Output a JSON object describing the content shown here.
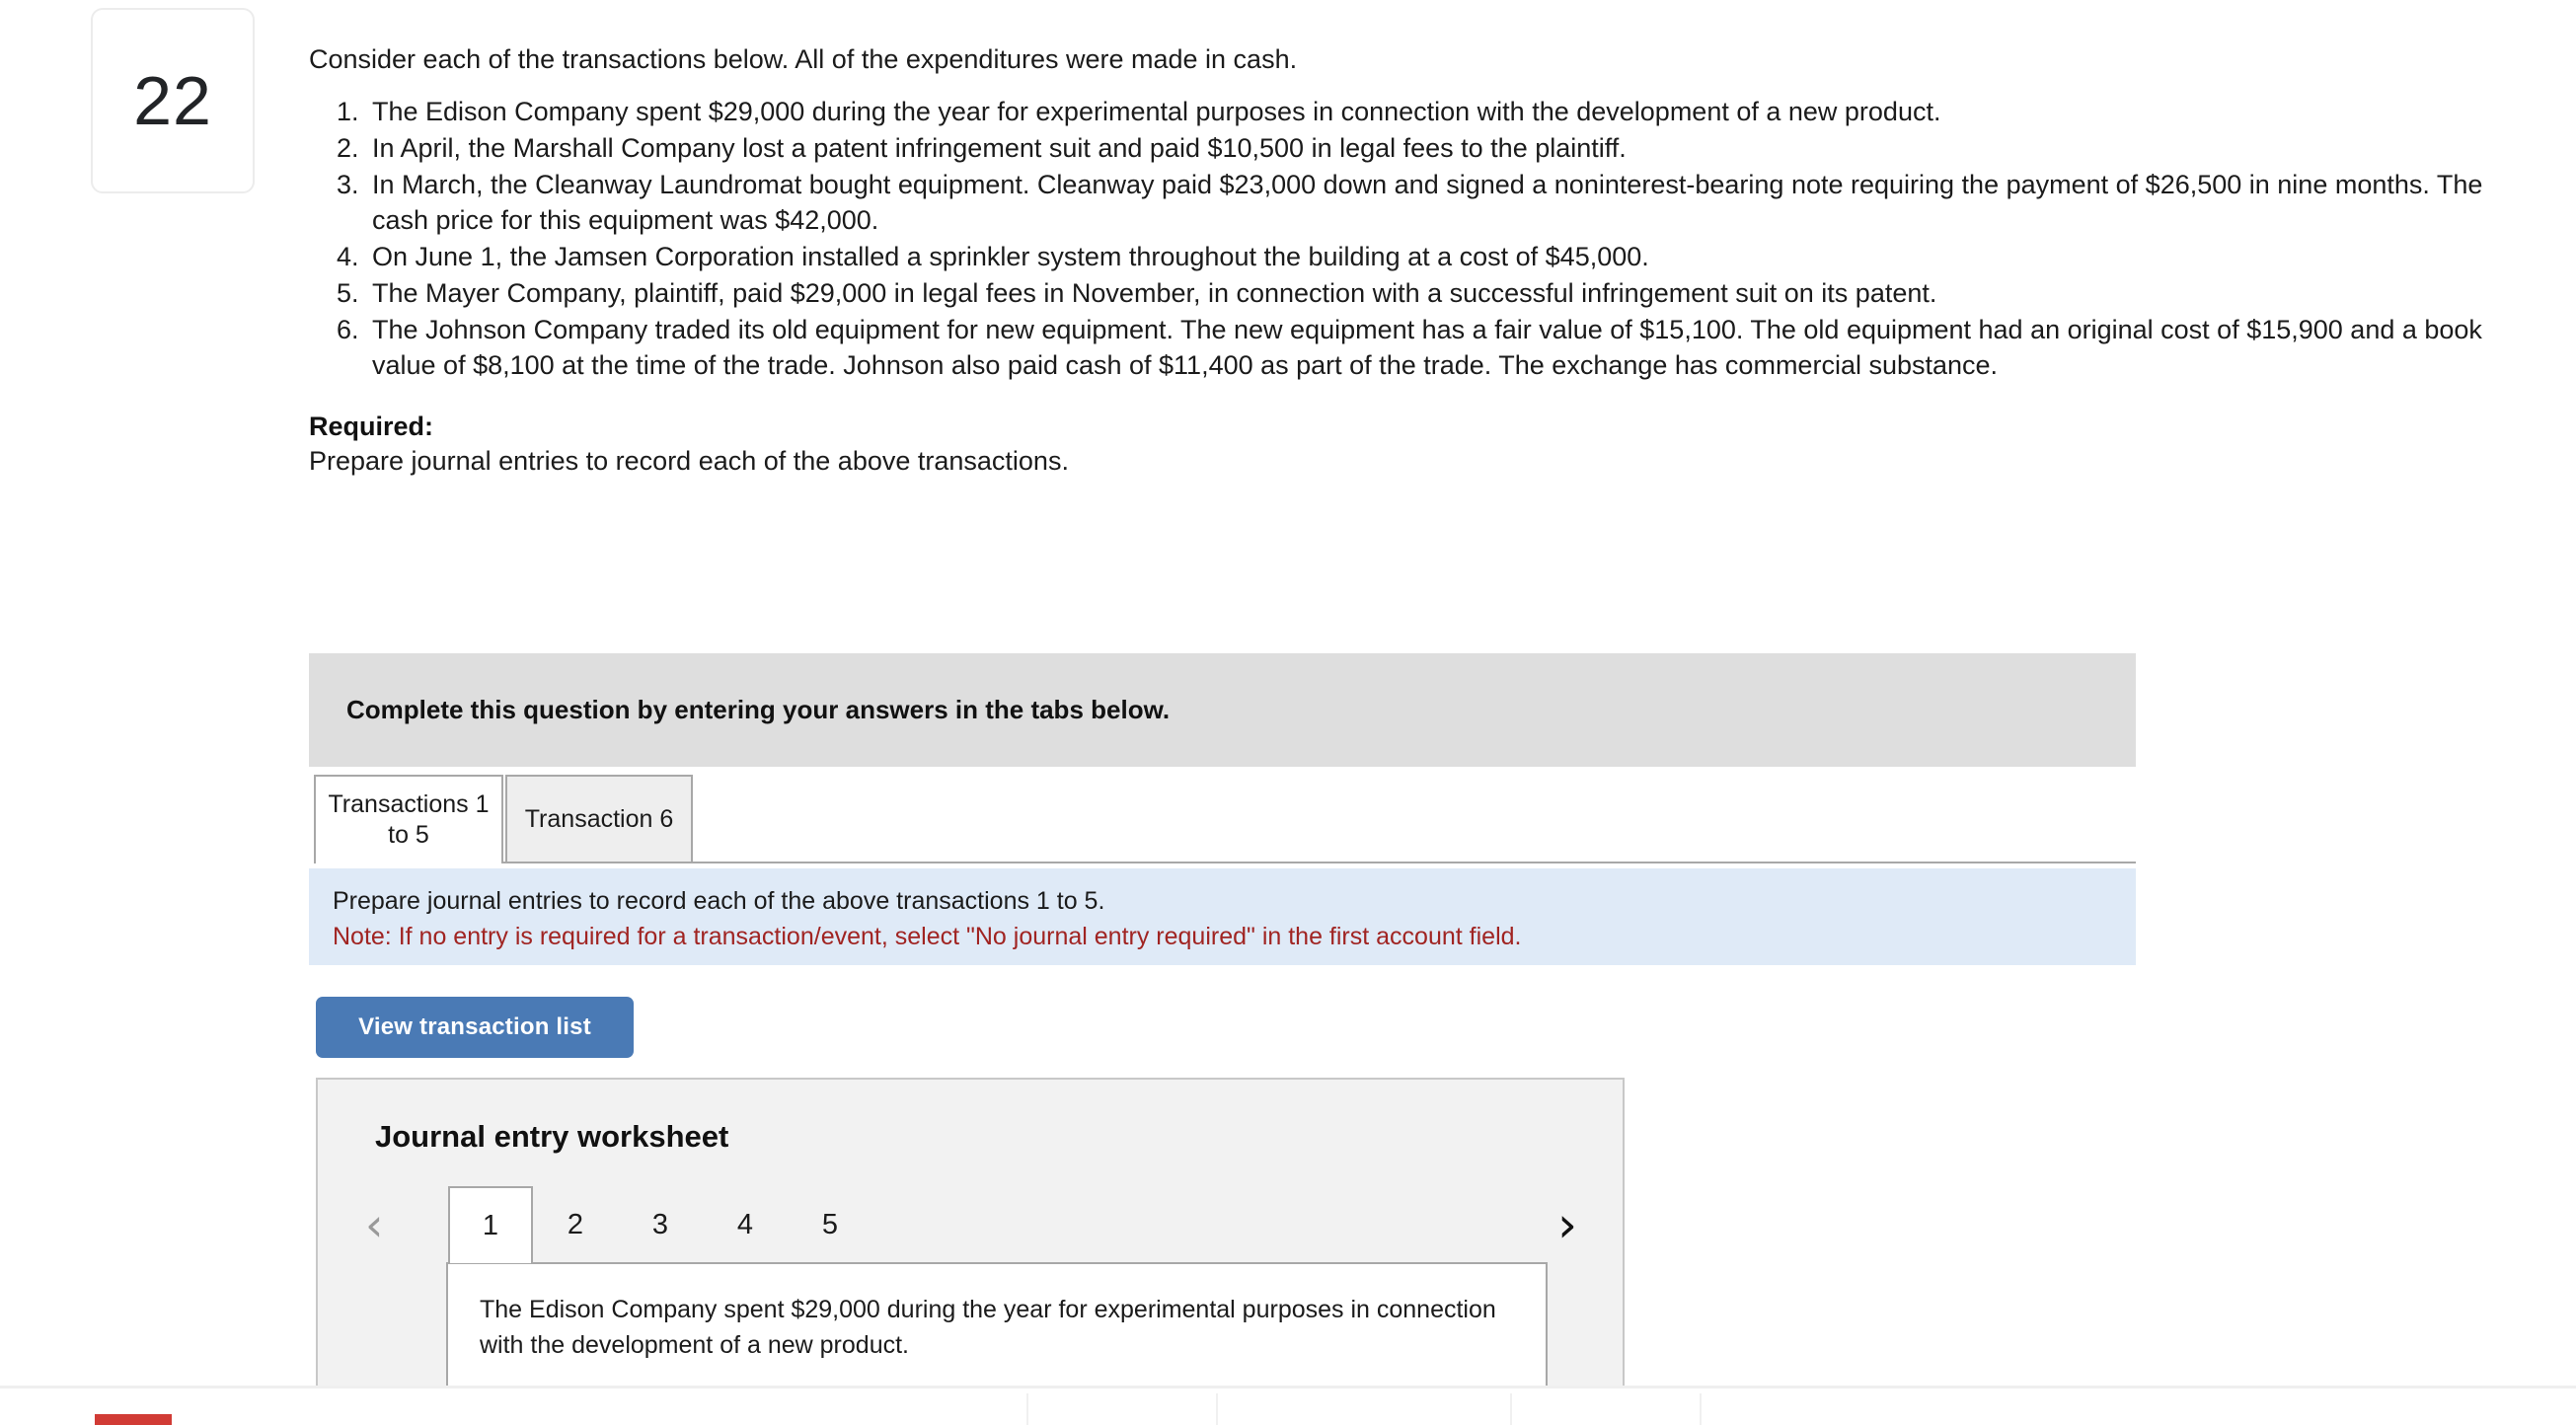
{
  "question": {
    "number": "22",
    "intro": "Consider each of the transactions below. All of the expenditures were made in cash.",
    "transactions": [
      "The Edison Company spent $29,000 during the year for experimental purposes in connection with the development of a new product.",
      "In April, the Marshall Company lost a patent infringement suit and paid $10,500 in legal fees to the plaintiff.",
      "In March, the Cleanway Laundromat bought equipment. Cleanway paid $23,000 down and signed a noninterest-bearing note requiring the payment of $26,500 in nine months. The cash price for this equipment was $42,000.",
      "On June 1, the Jamsen Corporation installed a sprinkler system throughout the building at a cost of $45,000.",
      "The Mayer Company, plaintiff, paid $29,000 in legal fees in November, in connection with a successful infringement suit on its patent.",
      "The Johnson Company traded its old equipment for new equipment. The new equipment has a fair value of $15,100. The old equipment had an original cost of $15,900 and a book value of $8,100 at the time of the trade. Johnson also paid cash of $11,400 as part of the trade. The exchange has commercial substance."
    ],
    "required_label": "Required:",
    "required_text": "Prepare journal entries to record each of the above transactions."
  },
  "banner": {
    "text": "Complete this question by entering your answers in the tabs below."
  },
  "tabs": [
    {
      "label": "Transactions 1 to 5",
      "active": true
    },
    {
      "label": "Transaction 6",
      "active": false
    }
  ],
  "info_box": {
    "instruction": "Prepare journal entries to record each of the above transactions 1 to 5.",
    "note": "Note: If no entry is required for a transaction/event, select \"No journal entry required\" in the first account field.",
    "note_color": "#a02422",
    "background": "#dfeaf7"
  },
  "buttons": {
    "view_transaction_list": "View transaction list",
    "view_transaction_list_color": "#4a7ab5"
  },
  "worksheet": {
    "title": "Journal entry worksheet",
    "prev_icon": "chevron-left-icon",
    "next_icon": "chevron-right-icon",
    "prev_glyph": "‹",
    "next_glyph": "›",
    "pages": [
      "1",
      "2",
      "3",
      "4",
      "5"
    ],
    "active_page": "1",
    "entry_text": "The Edison Company spent $29,000 during the year for experimental purposes in connection with the development of a new product."
  },
  "footer": {
    "accent_color": "#d13b35"
  }
}
